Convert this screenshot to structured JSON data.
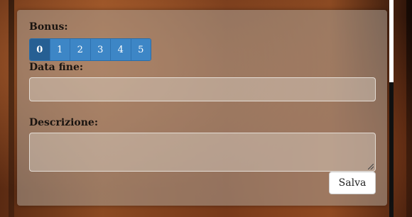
{
  "form": {
    "bonus_label": "Bonus:",
    "bonus_options": [
      "0",
      "1",
      "2",
      "3",
      "4",
      "5"
    ],
    "bonus_selected": "0",
    "end_date_label": "Data fine:",
    "end_date_value": "",
    "description_label": "Descrizione:",
    "description_value": "",
    "save_label": "Salva"
  },
  "colors": {
    "accent": "#3d86c6",
    "accent_active": "#265f93"
  }
}
